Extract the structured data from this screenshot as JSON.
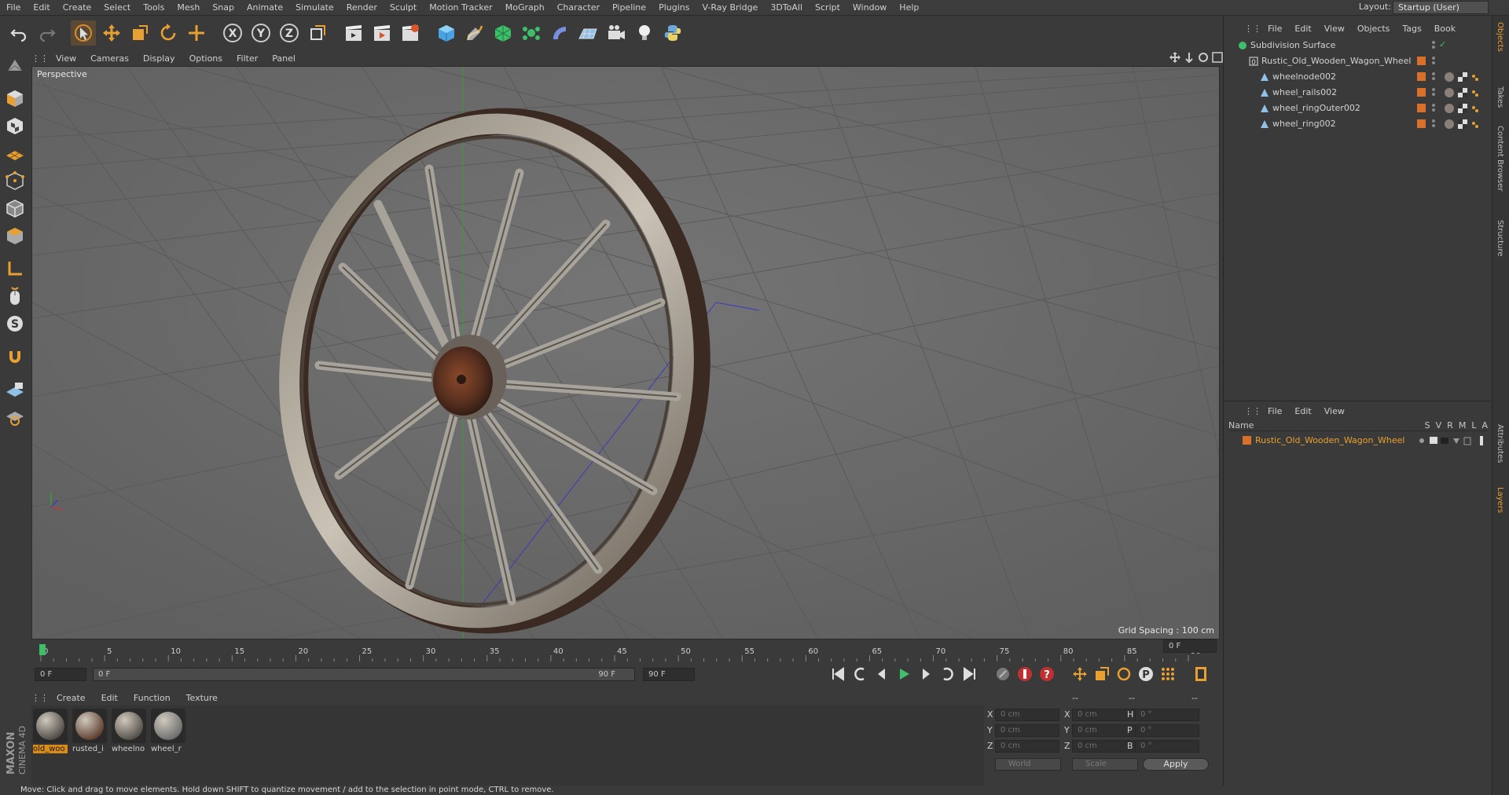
{
  "menubar": {
    "items": [
      "File",
      "Edit",
      "Create",
      "Select",
      "Tools",
      "Mesh",
      "Snap",
      "Animate",
      "Simulate",
      "Render",
      "Sculpt",
      "Motion Tracker",
      "MoGraph",
      "Character",
      "Pipeline",
      "Plugins",
      "V-Ray Bridge",
      "3DToAll",
      "Script",
      "Window",
      "Help"
    ],
    "layout_label": "Layout:",
    "layout_value": "Startup (User)"
  },
  "viewport": {
    "menu": [
      "View",
      "Cameras",
      "Display",
      "Options",
      "Filter",
      "Panel"
    ],
    "label": "Perspective",
    "grid_spacing": "Grid Spacing : 100 cm"
  },
  "timeline": {
    "ticks": [
      "0",
      "5",
      "10",
      "15",
      "20",
      "25",
      "30",
      "35",
      "40",
      "45",
      "50",
      "55",
      "60",
      "65",
      "70",
      "75",
      "80",
      "85",
      "90"
    ],
    "current_frame": "0 F",
    "start_field": "0 F",
    "range_start": "0 F",
    "range_end": "90 F",
    "end_field": "90 F"
  },
  "materials": {
    "menu": [
      "Create",
      "Edit",
      "Function",
      "Texture"
    ],
    "items": [
      {
        "name": "old_woo",
        "selected": true,
        "color": "#4a4540"
      },
      {
        "name": "rusted_i",
        "selected": false,
        "color": "#5a3a2a"
      },
      {
        "name": "wheelno",
        "selected": false,
        "color": "#4f4a45"
      },
      {
        "name": "wheel_r",
        "selected": false,
        "color": "#6a6a6a"
      }
    ]
  },
  "coords": {
    "header": [
      "--",
      "--",
      "--"
    ],
    "rows": [
      {
        "a": "X",
        "av": "0 cm",
        "b": "X",
        "bv": "0 cm",
        "c": "H",
        "cv": "0 °"
      },
      {
        "a": "Y",
        "av": "0 cm",
        "b": "Y",
        "bv": "0 cm",
        "c": "P",
        "cv": "0 °"
      },
      {
        "a": "Z",
        "av": "0 cm",
        "b": "Z",
        "bv": "0 cm",
        "c": "B",
        "cv": "0 °"
      }
    ],
    "world": "World",
    "scale": "Scale",
    "apply": "Apply"
  },
  "status": "Move: Click and drag to move elements. Hold down SHIFT to quantize movement / add to the selection in point mode, CTRL to remove.",
  "object_manager": {
    "menu": [
      "File",
      "Edit",
      "View",
      "Objects",
      "Tags",
      "Book"
    ],
    "objects": [
      {
        "name": "Subdivision Surface",
        "level": 0
      },
      {
        "name": "Rustic_Old_Wooden_Wagon_Wheel",
        "level": 1
      },
      {
        "name": "wheelnode002",
        "level": 2
      },
      {
        "name": "wheel_rails002",
        "level": 2
      },
      {
        "name": "wheel_ringOuter002",
        "level": 2
      },
      {
        "name": "wheel_ring002",
        "level": 2
      }
    ]
  },
  "layer_manager": {
    "menu": [
      "File",
      "Edit",
      "View"
    ],
    "header_name": "Name",
    "header_flags": [
      "S",
      "V",
      "R",
      "M",
      "L",
      "A"
    ],
    "layers": [
      {
        "name": "Rustic_Old_Wooden_Wagon_Wheel",
        "color": "#d9702a"
      }
    ]
  },
  "side_tabs": [
    "Objects",
    "Takes",
    "Content Browser",
    "Structure",
    "Attributes",
    "Layers"
  ],
  "logo": {
    "brand": "MAXON",
    "product": "CINEMA 4D"
  }
}
